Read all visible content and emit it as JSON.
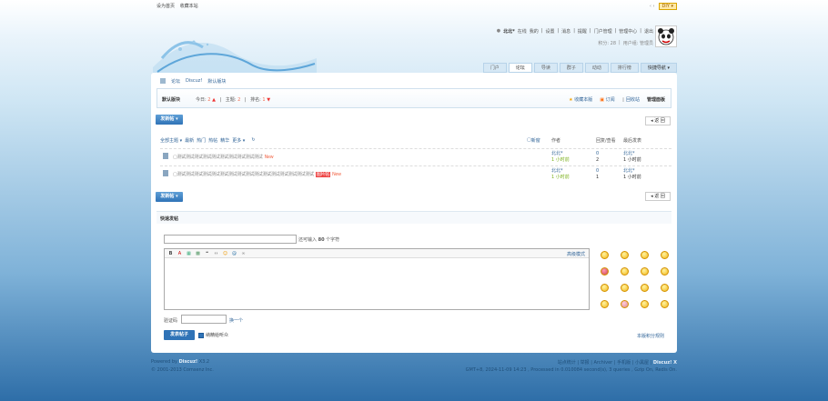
{
  "topbar": {
    "set_home": "设为首页",
    "favorite": "收藏本站",
    "arrows": "‹ ›",
    "diy": "DIY"
  },
  "user": {
    "name": "北北*",
    "online": "在线",
    "links": [
      "我的",
      "设置",
      "消息",
      "提醒",
      "门户管理",
      "管理中心",
      "退出"
    ],
    "credits": "积分: 28",
    "group": "用户组: 管理员"
  },
  "nav": {
    "tabs": [
      "门户",
      "论坛",
      "导读",
      "群子",
      "动动",
      "排行榜",
      "快捷导航"
    ]
  },
  "breadcrumb": [
    "论坛",
    "Discuz!",
    "默认版块"
  ],
  "forum": {
    "name": "默认版块",
    "today_label": "今日:",
    "today": "2",
    "topics_label": "主题:",
    "topics": "2",
    "rank_label": "排名:",
    "rank": "1",
    "favorite": "收藏本版",
    "subscribe": "订阅",
    "recycle": "回收站",
    "manage": "管理面板"
  },
  "buttons": {
    "post": "发新帖",
    "back": "返 回",
    "submit": "发表帖子"
  },
  "filters": {
    "all": "全部主题",
    "items": [
      "最新",
      "热门",
      "热帖",
      "精华",
      "更多"
    ],
    "newwin": "新窗",
    "author": "作者",
    "replies": "回复/查看",
    "lastpost": "最后发表"
  },
  "threads": [
    {
      "title": "测试测试测试测试测试测试测试测试测试测试",
      "badge": "",
      "new": "New",
      "author": "北北*",
      "author_time": "1 小时前",
      "replies": "0",
      "views": "2",
      "last_user": "北北*",
      "last_time": "1 小时前"
    },
    {
      "title": "测试测试测试测试测试测试测试测试测试测试测试测试测试测试测试测试",
      "badge": "图片帖",
      "new": "New",
      "author": "北北*",
      "author_time": "1 小时前",
      "replies": "0",
      "views": "1",
      "last_user": "北北*",
      "last_time": "1 小时前"
    }
  ],
  "quick": {
    "title": "快速发帖",
    "subject_tip_prefix": "还可输入",
    "subject_tip_num": "80",
    "subject_tip_suffix": "个字符",
    "advanced": "高级模式",
    "captcha_label": "验证码",
    "captcha_refresh": "换一个",
    "notify": "纳精给听众",
    "rules": "本版积分规则"
  },
  "footer": {
    "powered": "Powered by",
    "brand": "Discuz!",
    "version": "X3.2",
    "copyright": "© 2001-2013 Comsenz Inc.",
    "right_links": "站点统计 | 举报 | Archiver | 手机版 | 小黑屋 |",
    "right_brand": "Discuz! X",
    "runtime": "GMT+8, 2024-11-09 14:23 , Processed in 0.010084 second(s), 3 queries , Gzip On, Redis On."
  }
}
